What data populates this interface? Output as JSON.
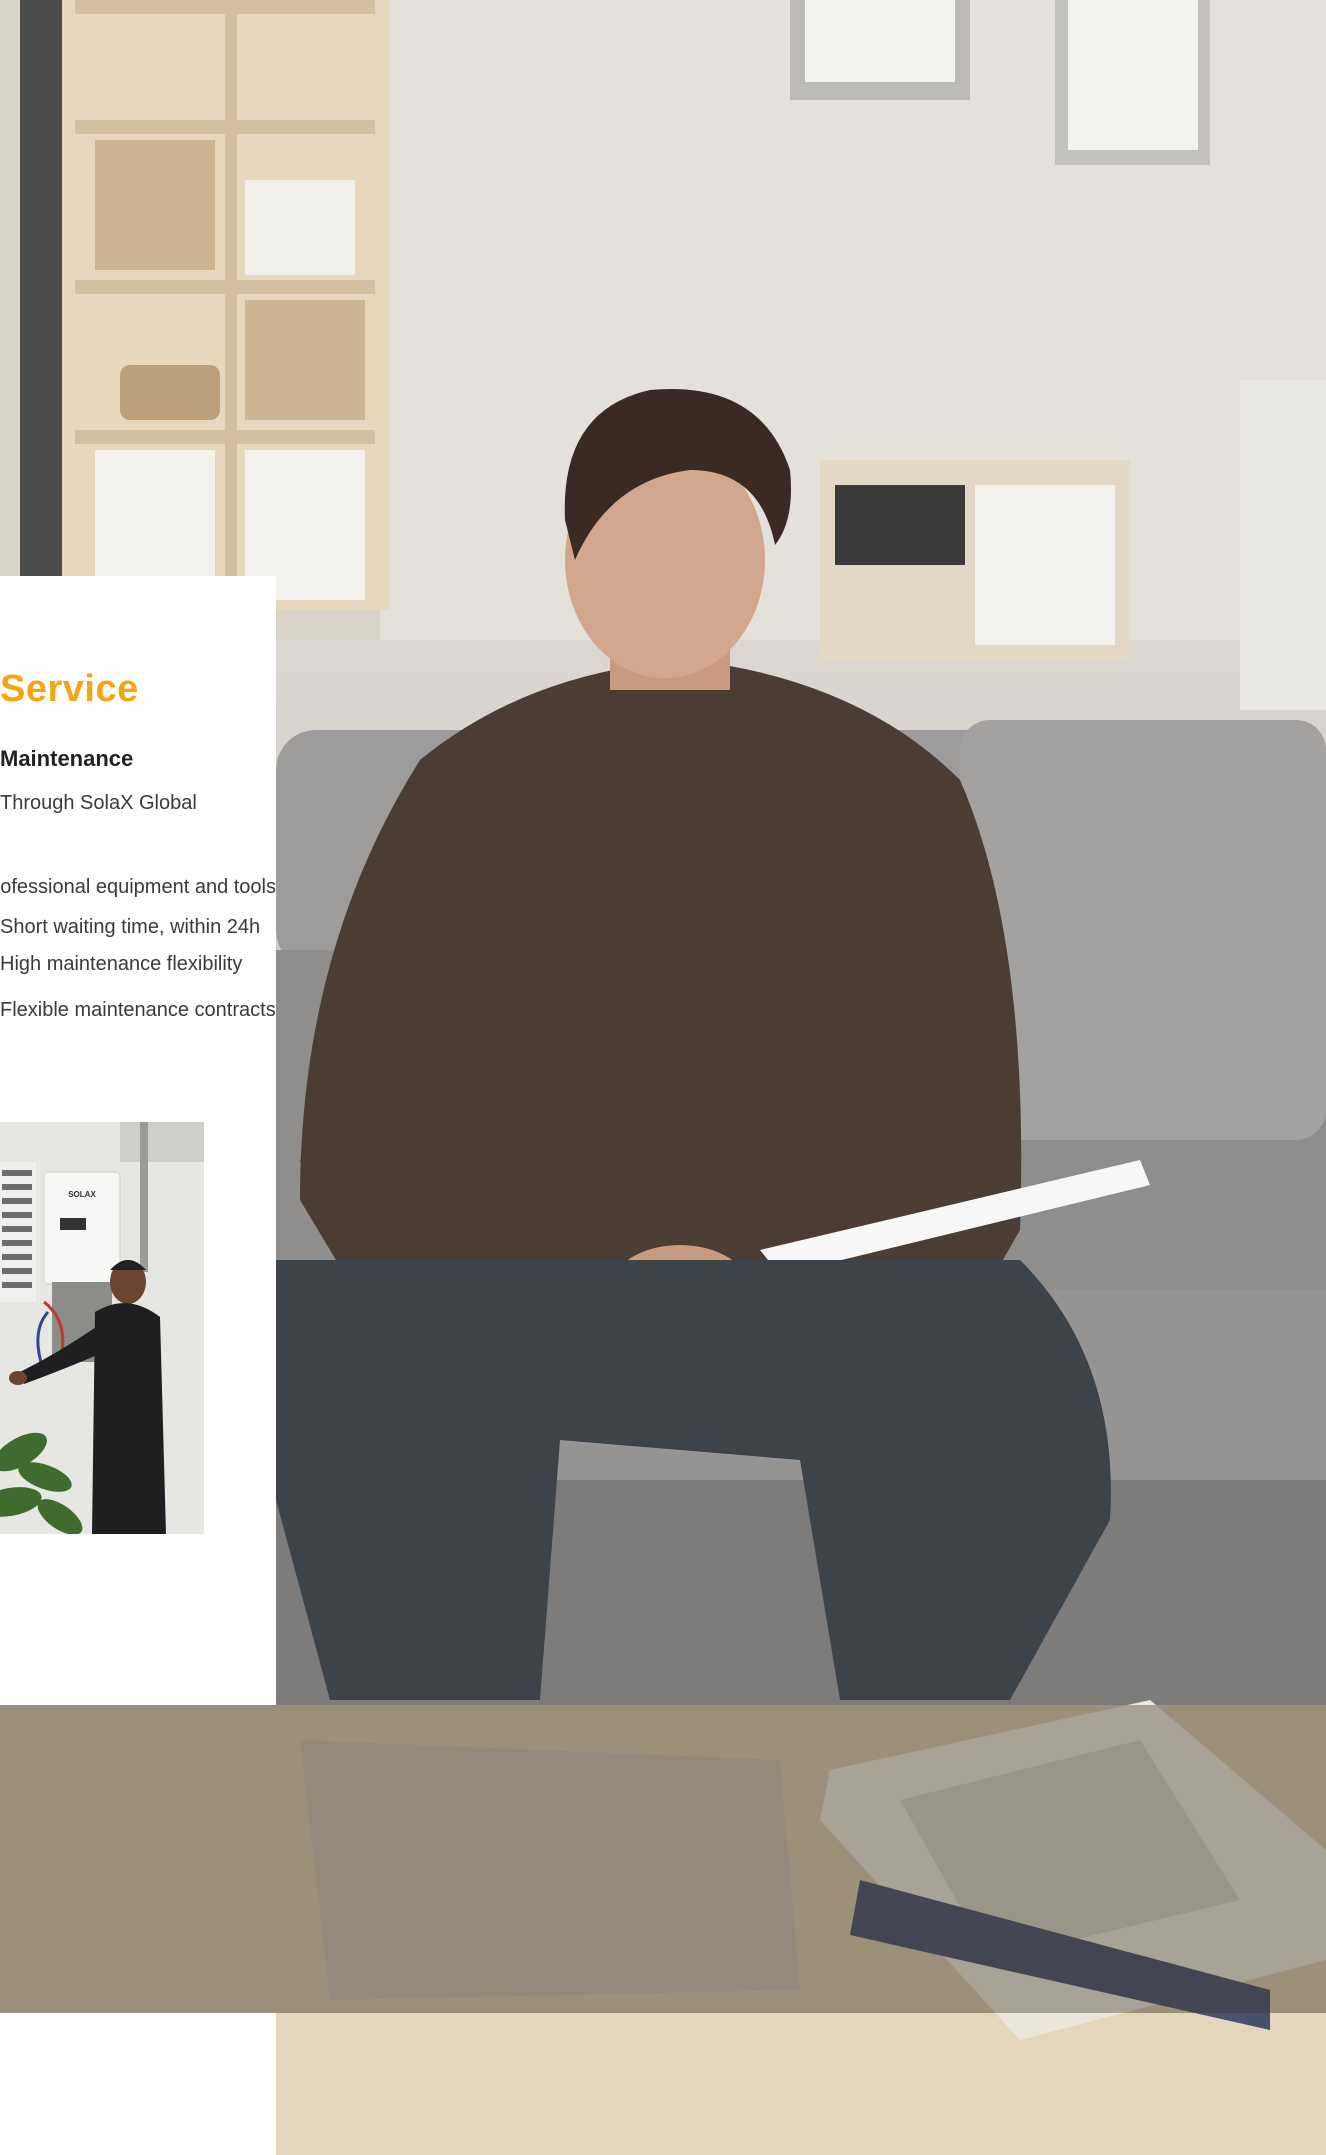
{
  "panel": {
    "title": "Service",
    "subtitle": "Maintenance",
    "lines": [
      "Through SolaX Global",
      "Professional equipment and tools",
      "Short waiting time, within 24h",
      "High maintenance flexibility",
      "Flexible maintenance contracts"
    ]
  },
  "tech_photo": {
    "device_brand": "SOLAX"
  },
  "colors": {
    "accent": "#f5a511",
    "band": "#9b8e7b"
  }
}
